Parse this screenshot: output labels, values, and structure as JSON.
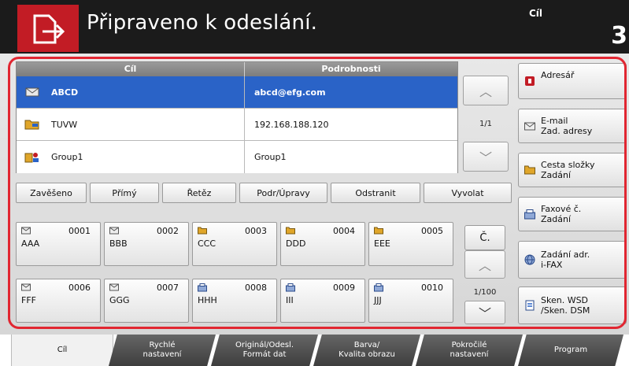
{
  "header": {
    "status": "Připraveno k odeslání.",
    "dest_label": "Cíl",
    "dest_count": "3"
  },
  "table": {
    "col_dest": "Cíl",
    "col_detail": "Podrobnosti",
    "rows": [
      {
        "name": "ABCD",
        "detail": "abcd@efg.com",
        "icon": "email-icon",
        "selected": true
      },
      {
        "name": "TUVW",
        "detail": "192.168.188.120",
        "icon": "folder-icon",
        "selected": false
      },
      {
        "name": "Group1",
        "detail": "Group1",
        "icon": "group-icon",
        "selected": false
      }
    ],
    "page": "1/1"
  },
  "actions": [
    "Zavěšeno",
    "Přímý",
    "Řetěz",
    "Podr/Úpravy",
    "Odstranit",
    "Vyvolat"
  ],
  "keys": [
    {
      "num": "0001",
      "name": "AAA",
      "icon": "email-icon"
    },
    {
      "num": "0002",
      "name": "BBB",
      "icon": "email-icon"
    },
    {
      "num": "0003",
      "name": "CCC",
      "icon": "folder-icon"
    },
    {
      "num": "0004",
      "name": "DDD",
      "icon": "folder-icon"
    },
    {
      "num": "0005",
      "name": "EEE",
      "icon": "folder-icon"
    },
    {
      "num": "0006",
      "name": "FFF",
      "icon": "email-icon"
    },
    {
      "num": "0007",
      "name": "GGG",
      "icon": "email-icon"
    },
    {
      "num": "0008",
      "name": "HHH",
      "icon": "fax-icon"
    },
    {
      "num": "0009",
      "name": "III",
      "icon": "fax-icon"
    },
    {
      "num": "0010",
      "name": "JJJ",
      "icon": "fax-icon"
    }
  ],
  "keys_nav": {
    "number_label": "Č.",
    "page": "1/100"
  },
  "side_buttons": [
    {
      "line1": "Adresář",
      "line2": "",
      "icon": "addressbook-icon"
    },
    {
      "line1": "E-mail",
      "line2": "Zad. adresy",
      "icon": "email-icon"
    },
    {
      "line1": "Cesta složky",
      "line2": "Zadání",
      "icon": "folder-icon"
    },
    {
      "line1": "Faxové č.",
      "line2": "Zadání",
      "icon": "fax-icon"
    },
    {
      "line1": "Zadání adr.",
      "line2": "i-FAX",
      "icon": "ifax-icon"
    },
    {
      "line1": "Sken. WSD",
      "line2": "/Sken. DSM",
      "icon": "scan-icon"
    }
  ],
  "tabs": [
    {
      "line1": "Cíl",
      "line2": ""
    },
    {
      "line1": "Rychlé",
      "line2": "nastavení"
    },
    {
      "line1": "Originál/Odesl.",
      "line2": "Formát dat"
    },
    {
      "line1": "Barva/",
      "line2": "Kvalita obrazu"
    },
    {
      "line1": "Pokročilé",
      "line2": "nastavení"
    },
    {
      "line1": "Program",
      "line2": ""
    }
  ],
  "colors": {
    "accent": "#e12631",
    "selection": "#2a63c7",
    "header": "#1b1b1b"
  }
}
